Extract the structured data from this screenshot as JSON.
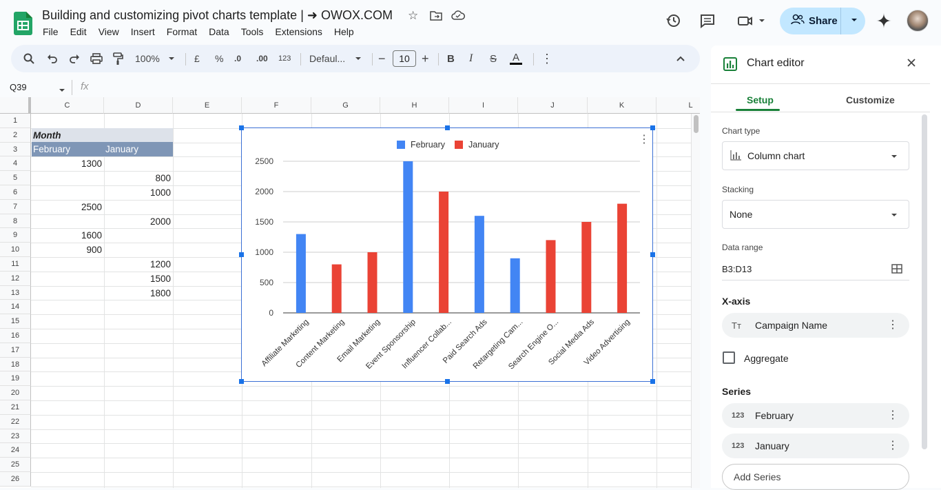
{
  "doc": {
    "title": "Building and customizing pivot charts template | ➜ OWOX.COM"
  },
  "menu": [
    "File",
    "Edit",
    "View",
    "Insert",
    "Format",
    "Data",
    "Tools",
    "Extensions",
    "Help"
  ],
  "header": {
    "share_label": "Share"
  },
  "toolbar": {
    "zoom": "100%",
    "currency": "£",
    "percent": "%",
    "dec_decrease": ".0",
    "dec_increase": ".00",
    "number_format": "123",
    "font": "Defaul...",
    "font_size": "10",
    "bold": "B",
    "italic": "I",
    "strike": "S",
    "text_color": "A"
  },
  "formula_bar": {
    "cell_ref": "Q39",
    "fx": "fx"
  },
  "sheet": {
    "columns": [
      "C",
      "D",
      "E",
      "F",
      "G",
      "H",
      "I",
      "J",
      "K",
      "L"
    ],
    "rows": [
      "1",
      "2",
      "3",
      "4",
      "5",
      "6",
      "7",
      "8",
      "9",
      "10",
      "11",
      "12",
      "13",
      "14",
      "15",
      "16",
      "17",
      "18",
      "19",
      "20",
      "21",
      "22",
      "23",
      "24",
      "25",
      "26"
    ],
    "header_label": "Month",
    "col_c_header": "February",
    "col_d_header": "January",
    "c_values": [
      "1300",
      "",
      "",
      "2500",
      "",
      "1600",
      "900",
      "",
      "",
      ""
    ],
    "d_values": [
      "",
      "800",
      "1000",
      "",
      "2000",
      "",
      "",
      "1200",
      "1500",
      "1800"
    ]
  },
  "chart_data": {
    "type": "bar",
    "categories": [
      "Affiliate Marketing",
      "Content Marketing",
      "Email Marketing",
      "Event Sponsorship",
      "Influencer Collab...",
      "Paid Search Ads",
      "Retargeting Cam...",
      "Search Engine O...",
      "Social Media Ads",
      "Video Advertising"
    ],
    "series": [
      {
        "name": "February",
        "color": "#4285f4",
        "values": [
          1300,
          null,
          null,
          2500,
          null,
          1600,
          900,
          null,
          null,
          null
        ]
      },
      {
        "name": "January",
        "color": "#ea4335",
        "values": [
          null,
          800,
          1000,
          null,
          2000,
          null,
          null,
          1200,
          1500,
          1800
        ]
      }
    ],
    "ylim": [
      0,
      2500
    ],
    "yticks": [
      "0",
      "500",
      "1000",
      "1500",
      "2000",
      "2500"
    ],
    "legend": "top",
    "grid": true
  },
  "editor": {
    "title": "Chart editor",
    "tab_setup": "Setup",
    "tab_customize": "Customize",
    "chart_type_label": "Chart type",
    "chart_type_value": "Column chart",
    "stacking_label": "Stacking",
    "stacking_value": "None",
    "data_range_label": "Data range",
    "data_range_value": "B3:D13",
    "xaxis_label": "X-axis",
    "xaxis_value": "Campaign Name",
    "aggregate_label": "Aggregate",
    "series_label": "Series",
    "series": [
      "February",
      "January"
    ],
    "add_series": "Add Series",
    "num_icon": "123",
    "text_icon": "Tт"
  }
}
